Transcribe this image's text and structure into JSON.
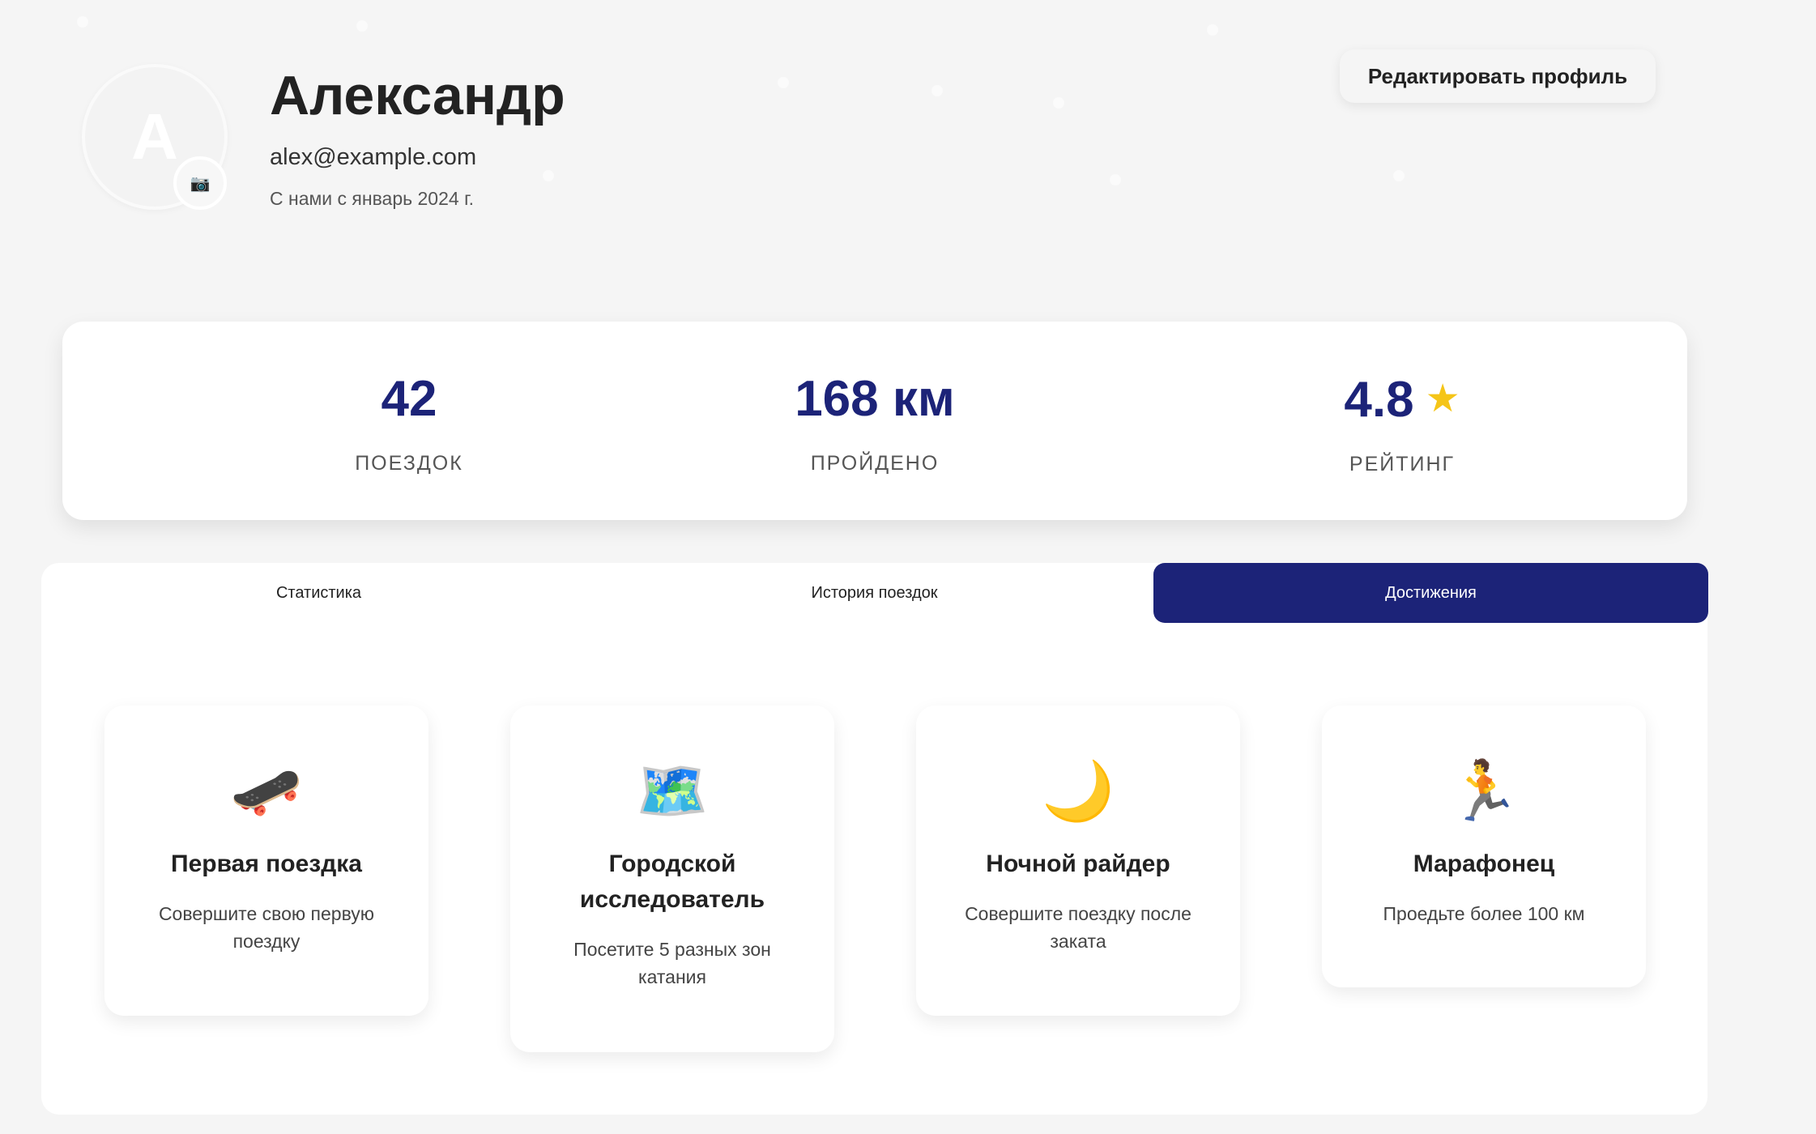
{
  "profile": {
    "avatar_letter": "A",
    "camera_icon": "📷",
    "name": "Александр",
    "email": "alex@example.com",
    "member_since": "С нами с январь 2024 г.",
    "edit_button": "Редактировать профиль"
  },
  "stats": [
    {
      "value": "42",
      "label": "ПОЕЗДОК"
    },
    {
      "value": "168 км",
      "label": "ПРОЙДЕНО"
    },
    {
      "value": "4.8",
      "star": "★",
      "label": "РЕЙТИНГ"
    }
  ],
  "tabs": [
    {
      "label": "Статистика",
      "active": false
    },
    {
      "label": "История поездок",
      "active": false
    },
    {
      "label": "Достижения",
      "active": true
    }
  ],
  "achievements": [
    {
      "icon": "🛹",
      "icon_name": "skateboard-icon",
      "title": "Первая поездка",
      "description": "Совершите свою первую поездку"
    },
    {
      "icon": "🗺️",
      "icon_name": "world-map-icon",
      "title": "Городской исследователь",
      "description": "Посетите 5 разных зон катания"
    },
    {
      "icon": "🌙",
      "icon_name": "crescent-moon-icon",
      "title": "Ночной райдер",
      "description": "Совершите поездку после заката"
    },
    {
      "icon": "🏃",
      "icon_name": "runner-icon",
      "title": "Марафонец",
      "description": "Проедьте более 100 км"
    }
  ],
  "colors": {
    "accent": "#1c2378",
    "star": "#f5c518",
    "background": "#f5f5f5"
  }
}
